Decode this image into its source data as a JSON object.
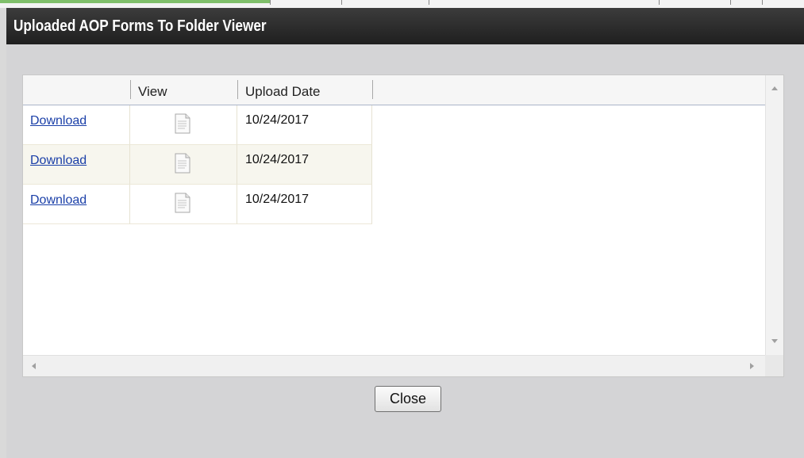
{
  "dialog": {
    "title": "Uploaded AOP Forms To Folder Viewer",
    "close_label": "Close"
  },
  "grid": {
    "columns": [
      "",
      "View",
      "Upload Date"
    ],
    "rows": [
      {
        "download_label": "Download",
        "view_icon": "document-icon",
        "upload_date": "10/24/2017"
      },
      {
        "download_label": "Download",
        "view_icon": "document-icon",
        "upload_date": "10/24/2017"
      },
      {
        "download_label": "Download",
        "view_icon": "document-icon",
        "upload_date": "10/24/2017"
      }
    ]
  },
  "colors": {
    "titlebar": "#2b2b2b",
    "link": "#1a3fa8",
    "alt_row": "#f7f6ee"
  }
}
